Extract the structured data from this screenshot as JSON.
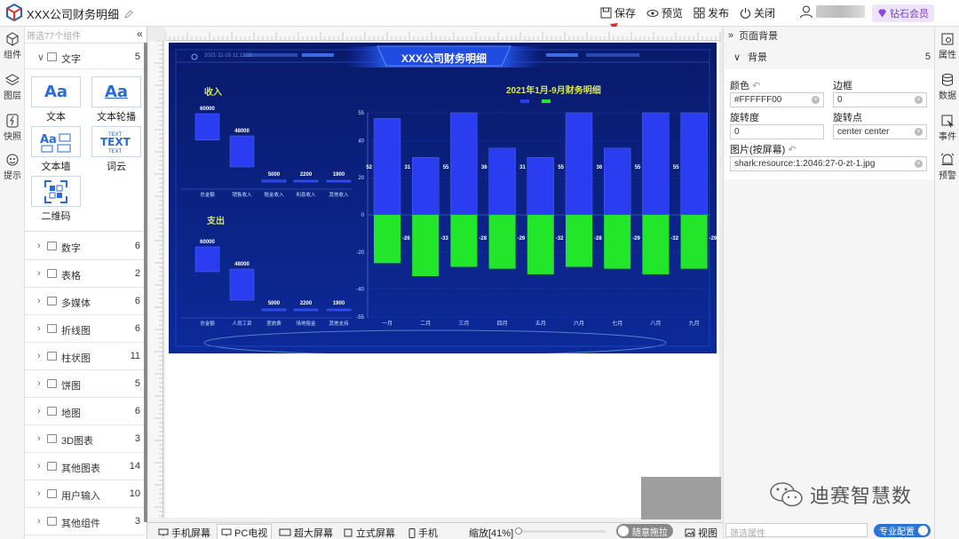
{
  "app": {
    "title": "XXX公司财务明细"
  },
  "toolbar": {
    "save": "保存",
    "preview": "预览",
    "publish": "发布",
    "close": "关闭",
    "vip": "钻石会员"
  },
  "rail_left": [
    {
      "label": "组件",
      "icon": "cube-icon"
    },
    {
      "label": "图层",
      "icon": "layers-icon"
    },
    {
      "label": "快照",
      "icon": "snapshot-icon"
    },
    {
      "label": "提示",
      "icon": "hint-icon"
    }
  ],
  "left_panel": {
    "filter_placeholder": "筛选77个组件",
    "collapse": "«",
    "open_category": {
      "label": "文字",
      "count": "5"
    },
    "tiles": [
      {
        "label": "文本"
      },
      {
        "label": "文本轮播"
      },
      {
        "label": "文本墙"
      },
      {
        "label": "词云"
      },
      {
        "label": "二维码"
      }
    ],
    "categories": [
      {
        "label": "数字",
        "count": "6"
      },
      {
        "label": "表格",
        "count": "2"
      },
      {
        "label": "多媒体",
        "count": "6"
      },
      {
        "label": "折线图",
        "count": "6"
      },
      {
        "label": "柱状图",
        "count": "11"
      },
      {
        "label": "饼图",
        "count": "5"
      },
      {
        "label": "地图",
        "count": "6"
      },
      {
        "label": "3D图表",
        "count": "3"
      },
      {
        "label": "其他图表",
        "count": "14"
      },
      {
        "label": "用户输入",
        "count": "10"
      },
      {
        "label": "其他组件",
        "count": "3"
      }
    ]
  },
  "dashboard": {
    "title": "XXX公司财务明细",
    "timestamp": "2021-11-03 11:11:21",
    "income_title": "收入",
    "expense_title": "支出",
    "right_chart_title": "2021年1月-9月财务明细"
  },
  "chart_data": [
    {
      "type": "bar",
      "title": "收入",
      "categories": [
        "总金额",
        "销售收入",
        "租金收入",
        "利息收入",
        "其他收入"
      ],
      "values": [
        60000,
        48000,
        5000,
        2200,
        1900
      ]
    },
    {
      "type": "bar",
      "title": "支出",
      "categories": [
        "总金额",
        "人员工资",
        "差旅费",
        "场地租金",
        "其他支持"
      ],
      "values": [
        60000,
        48000,
        5000,
        2200,
        1900
      ]
    },
    {
      "type": "bar",
      "title": "2021年1月-9月财务明细",
      "categories": [
        "一月",
        "二月",
        "三月",
        "四月",
        "五月",
        "六月",
        "七月",
        "八月",
        "九月"
      ],
      "series": [
        {
          "values": [
            52,
            31,
            55,
            36,
            31,
            55,
            36,
            55,
            55
          ],
          "value_labels": [
            "52",
            "31",
            "55",
            "36",
            "31",
            "55",
            "36",
            "55",
            "55"
          ],
          "color": "#2a3df0"
        },
        {
          "values": [
            -26,
            -33,
            -28,
            -29,
            -32,
            -28,
            -29,
            -32,
            -29
          ],
          "value_labels": [
            "-26",
            "-33",
            "-28",
            "-29",
            "-32",
            "-28",
            "-29",
            "-32",
            "-29"
          ],
          "color": "#22e62a"
        }
      ],
      "yticks": [
        "55",
        "40",
        "20",
        "0",
        "-20",
        "-40",
        "-55"
      ],
      "ylim": [
        -55,
        55
      ]
    }
  ],
  "bottom_tabs": [
    "手机屏幕",
    "PC电视",
    "超大屏幕",
    "立式屏幕",
    "手机"
  ],
  "zoom": "缩放[41%]",
  "drag_toggle": "随意拖拉",
  "view_label": "视图",
  "right_panel": {
    "header": "页面背景",
    "section": "背景",
    "section_count": "5",
    "color_label": "颜色",
    "color_value": "#FFFFFF00",
    "border_label": "边框",
    "border_value": "0",
    "rotation_label": "旋转度",
    "rotation_value": "0",
    "pivot_label": "旋转点",
    "pivot_value": "center center",
    "image_label": "图片(按屏幕)",
    "image_value": "shark:resource:1:2046:27-0-zt-1.jpg",
    "filter_placeholder": "筛选属性",
    "pro_config": "专业配置"
  },
  "rail_right": [
    {
      "label": "属性",
      "icon": "settings-icon"
    },
    {
      "label": "数据",
      "icon": "database-icon"
    },
    {
      "label": "事件",
      "icon": "event-icon"
    },
    {
      "label": "预警",
      "icon": "alarm-icon"
    }
  ],
  "watermark": "迪赛智慧数"
}
